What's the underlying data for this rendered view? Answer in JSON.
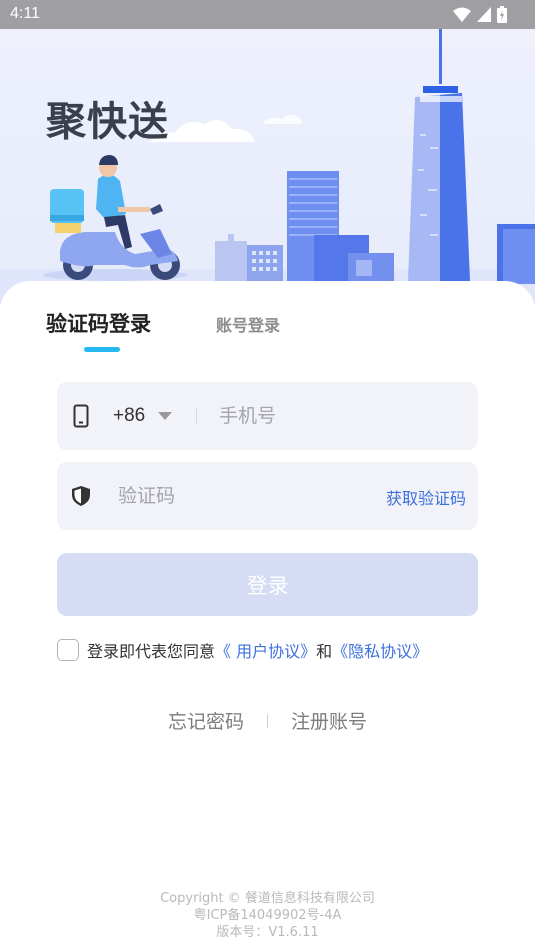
{
  "status_bar": {
    "time": "4:11",
    "icons": [
      "wifi-icon",
      "signal-icon",
      "battery-icon"
    ]
  },
  "brand": {
    "logo_text": "聚快送",
    "logo_color": "#3a3f4b",
    "accent_color": "#3d6fdd"
  },
  "tabs": [
    {
      "label": "验证码登录",
      "active": true
    },
    {
      "label": "账号登录",
      "active": false
    }
  ],
  "phone_field": {
    "icon": "phone-icon",
    "country_code": "+86",
    "placeholder": "手机号",
    "value": ""
  },
  "code_field": {
    "icon": "shield-icon",
    "placeholder": "验证码",
    "value": "",
    "get_code_label": "获取验证码"
  },
  "login_button": {
    "label": "登录",
    "enabled": false
  },
  "agreement": {
    "checked": false,
    "prefix": "登录即代表您同意",
    "user_agreement": "《 用户协议》",
    "conjunction": "和",
    "privacy_policy": "《隐私协议》"
  },
  "links": {
    "forgot_password": "忘记密码",
    "register": "注册账号"
  },
  "footer": {
    "copyright": "Copyright © 餐道信息科技有限公司",
    "icp": "粤ICP备14049902号-4A",
    "version": "版本号：V1.6.11"
  }
}
